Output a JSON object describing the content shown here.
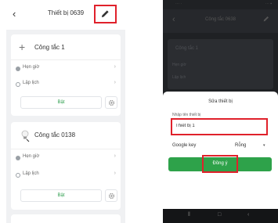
{
  "left": {
    "header": {
      "back_icon": "chevron-left-icon",
      "title": "Thiết bị 0639",
      "edit_icon": "pencil-icon"
    },
    "cards": [
      {
        "name": "Công tắc 1",
        "icon": "plus-icon",
        "timer_label": "Hẹn giờ",
        "schedule_label": "Lập lịch",
        "toggle_label": "Bật",
        "gear_icon": "gear-icon"
      },
      {
        "name": "Công tắc 0138",
        "icon": "bulb-icon",
        "timer_label": "Hẹn giờ",
        "schedule_label": "Lập lịch",
        "toggle_label": "Bật",
        "gear_icon": "gear-icon"
      }
    ]
  },
  "right": {
    "background": {
      "title": "Công tắc 0638",
      "card_name": "Công tắc 1",
      "timer_label": "Hẹn giờ",
      "schedule_label": "Lập lịch"
    },
    "dialog": {
      "title": "Sửa thiết bị",
      "name_label": "Nhập tên thiết bị",
      "name_value": "Thiết bị 1",
      "google_key_label": "Google key",
      "google_key_value": "Rỗng",
      "confirm_label": "Đồng ý"
    }
  },
  "colors": {
    "accent_green": "#2ea24a",
    "highlight_red": "#e0212b"
  }
}
